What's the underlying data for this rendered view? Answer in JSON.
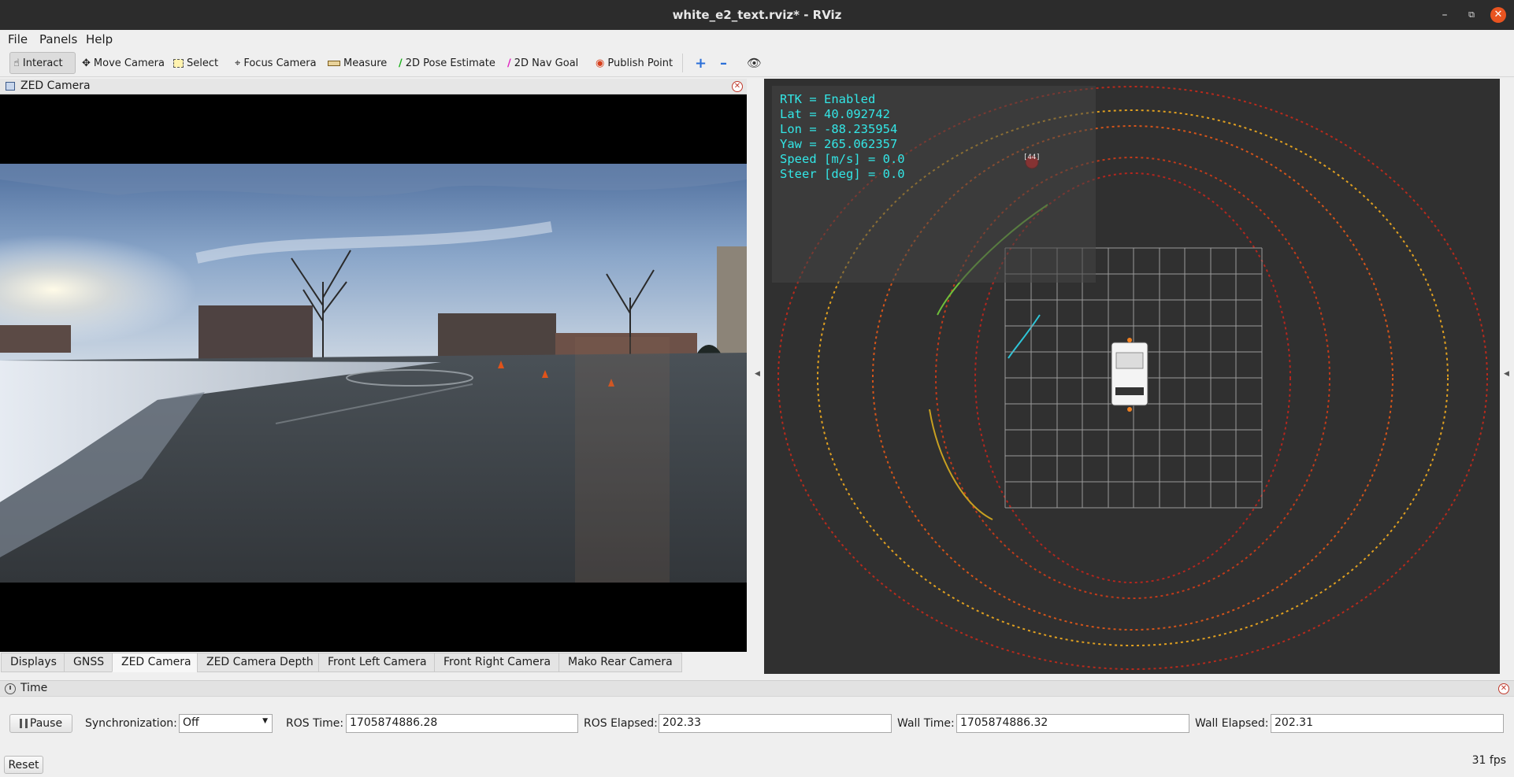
{
  "window": {
    "title": "white_e2_text.rviz* - RViz",
    "minimize_icon": "minimize-icon",
    "restore_icon": "restore-icon",
    "close_icon": "close-icon"
  },
  "menu": {
    "file": "File",
    "panels": "Panels",
    "help": "Help"
  },
  "toolbar": {
    "interact": "Interact",
    "move_camera": "Move Camera",
    "select": "Select",
    "focus_camera": "Focus Camera",
    "measure": "Measure",
    "pose_estimate": "2D Pose Estimate",
    "nav_goal": "2D Nav Goal",
    "publish_point": "Publish Point"
  },
  "left_panel": {
    "title": "ZED Camera"
  },
  "tabs": [
    "Displays",
    "GNSS",
    "ZED Camera",
    "ZED Camera Depth",
    "Front Left Camera",
    "Front Right Camera",
    "Mako Rear Camera"
  ],
  "selected_tab": "ZED Camera",
  "overlay": {
    "lines": [
      "RTK = Enabled",
      "Lat = 40.092742",
      "Lon = -88.235954",
      "Yaw = 265.062357",
      "Speed [m/s] = 0.0",
      "Steer [deg] = 0.0"
    ],
    "color": "#33e6e6"
  },
  "marker_label": "[44]",
  "time_panel": {
    "title": "Time",
    "pause_label": "Pause",
    "sync_label": "Synchronization:",
    "sync_value": "Off",
    "ros_time_label": "ROS Time:",
    "ros_time_value": "1705874886.28",
    "ros_elapsed_label": "ROS Elapsed:",
    "ros_elapsed_value": "202.33",
    "wall_time_label": "Wall Time:",
    "wall_time_value": "1705874886.32",
    "wall_elapsed_label": "Wall Elapsed:",
    "wall_elapsed_value": "202.31",
    "reset_label": "Reset"
  },
  "fps": "31 fps"
}
